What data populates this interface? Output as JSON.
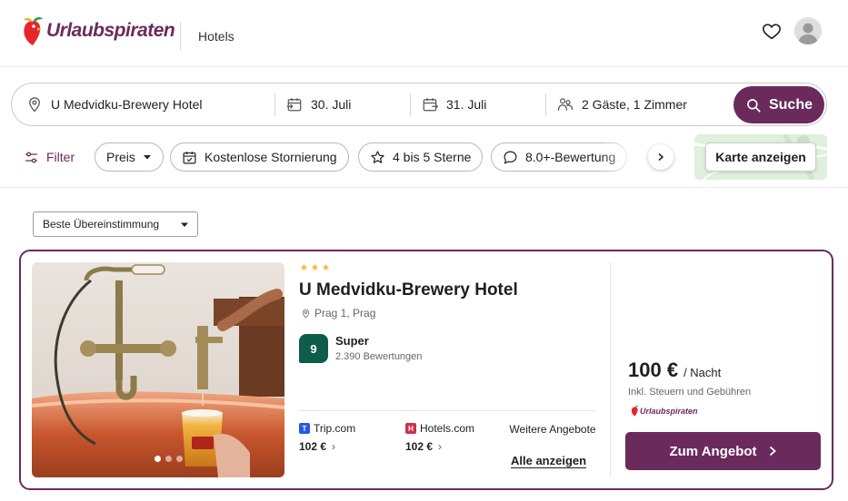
{
  "header": {
    "logo_text": "Urlaubspiraten",
    "nav_item": "Hotels",
    "wishlist_icon": "heart-icon",
    "avatar_icon": "user-avatar-icon"
  },
  "search": {
    "destination": "U Medvidku-Brewery Hotel",
    "checkin": "30. Juli",
    "checkout": "31. Juli",
    "guests": "2 Gäste, 1 Zimmer",
    "button_label": "Suche"
  },
  "filters": {
    "label": "Filter",
    "chips": [
      {
        "label": "Preis",
        "icon": "caret-down-icon"
      },
      {
        "label": "Kostenlose Stornierung",
        "icon": "calendar-check-icon"
      },
      {
        "label": "4 bis 5 Sterne",
        "icon": "star-icon"
      },
      {
        "label": "8.0+-Bewertung",
        "icon": "speech-bubble-icon"
      }
    ],
    "map_button": "Karte anzeigen"
  },
  "sort": {
    "selected": "Beste Übereinstimmung"
  },
  "hotel": {
    "stars": 3,
    "name": "U Medvidku-Brewery Hotel",
    "location": "Prag 1, Prag",
    "score": "9",
    "score_label": "Super",
    "reviews": "2.390 Bewertungen",
    "photo_count": 3,
    "active_photo": 1,
    "providers": [
      {
        "name": "Trip.com",
        "price": "102 €",
        "logo_color": "#2657e8",
        "logo_letter": "T"
      },
      {
        "name": "Hotels.com",
        "price": "102 €",
        "logo_color": "#d32f4a",
        "logo_letter": "H"
      }
    ],
    "more_offers": "Weitere Angebote",
    "more_link": "Alle anzeigen",
    "price": "100 €",
    "price_unit": "/ Nacht",
    "price_note": "Inkl. Steuern und Gebühren",
    "price_source": "Urlaubspiraten",
    "cta": "Zum Angebot"
  },
  "colors": {
    "brand": "#6b2a5c",
    "score_badge": "#0e5c4a",
    "star": "#f5b73b"
  }
}
